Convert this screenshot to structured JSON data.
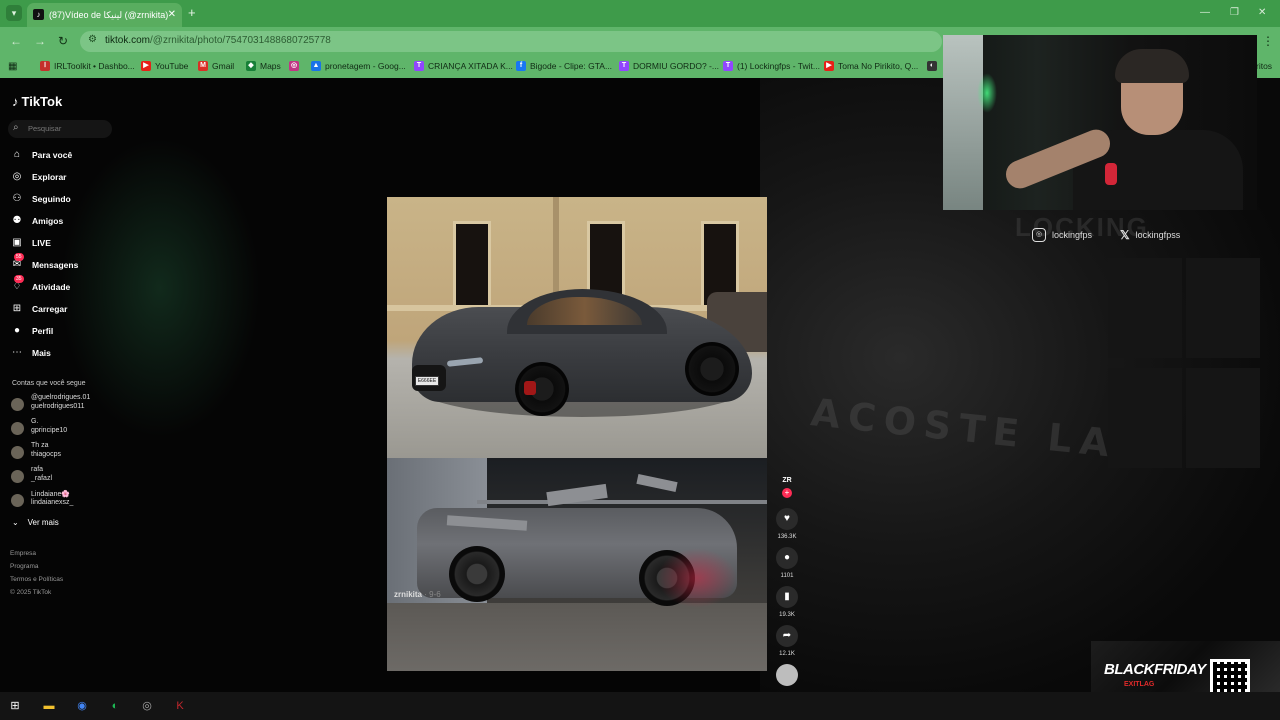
{
  "browser": {
    "tab_title": "(87)Vídeo de لينيكا (@zrnikita)",
    "url_host": "tiktok.com",
    "url_path": "/@zrnikita/photo/7547031488680725778",
    "bookmarks": [
      {
        "label": "IRLToolkit • Dashbo...",
        "icon": "irltoolkit-icon",
        "color": "#c4302b"
      },
      {
        "label": "YouTube",
        "icon": "youtube-icon",
        "color": "#e62117"
      },
      {
        "label": "Gmail",
        "icon": "gmail-icon",
        "color": "#d93025"
      },
      {
        "label": "Maps",
        "icon": "maps-icon",
        "color": "#188038"
      },
      {
        "label": "",
        "icon": "instagram-icon",
        "color": "#c13584"
      },
      {
        "label": "pronetagem - Goog...",
        "icon": "drive-icon",
        "color": "#1a73e8"
      },
      {
        "label": "CRIANÇA XITADA K...",
        "icon": "twitch-icon",
        "color": "#9146ff"
      },
      {
        "label": "Bigode - Clipe: GTA...",
        "icon": "facebook-icon",
        "color": "#1877f2"
      },
      {
        "label": "DORMIU GORDO? -...",
        "icon": "twitch-icon",
        "color": "#9146ff"
      },
      {
        "label": "(1) Lockingfps - Twit...",
        "icon": "twitch-icon",
        "color": "#9146ff"
      },
      {
        "label": "Toma No Pirikito, Q...",
        "icon": "youtube-icon",
        "color": "#e62117"
      },
      {
        "label": "",
        "icon": "misc-icon",
        "color": "#333333"
      }
    ],
    "bookmarks_overflow": "ritos"
  },
  "tiktok": {
    "logo": "TikTok",
    "search_placeholder": "Pesquisar",
    "nav": [
      {
        "label": "Para você",
        "icon": "home-icon",
        "badge": ""
      },
      {
        "label": "Explorar",
        "icon": "compass-icon",
        "badge": ""
      },
      {
        "label": "Seguindo",
        "icon": "following-icon",
        "badge": ""
      },
      {
        "label": "Amigos",
        "icon": "friends-icon",
        "badge": ""
      },
      {
        "label": "LIVE",
        "icon": "live-icon",
        "badge": ""
      },
      {
        "label": "Mensagens",
        "icon": "messages-icon",
        "badge": "55"
      },
      {
        "label": "Atividade",
        "icon": "activity-icon",
        "badge": "35"
      },
      {
        "label": "Carregar",
        "icon": "upload-icon",
        "badge": ""
      },
      {
        "label": "Perfil",
        "icon": "profile-icon",
        "badge": ""
      },
      {
        "label": "Mais",
        "icon": "more-icon",
        "badge": ""
      }
    ],
    "following_header": "Contas que você segue",
    "following": [
      {
        "name": "@guelrodrigues.01",
        "handle": "guelrodrigues011"
      },
      {
        "name": "G.",
        "handle": "gprincipe10"
      },
      {
        "name": "Th za",
        "handle": "thiagocps"
      },
      {
        "name": "rafa",
        "handle": "_rafazl"
      },
      {
        "name": "Lindaiane🌸",
        "handle": "lindaianexsz_"
      }
    ],
    "see_more": "Ver mais",
    "footer": [
      "Empresa",
      "Programa",
      "Termos e Políticas",
      "© 2025 TikTok"
    ],
    "post": {
      "author": "zrnikita",
      "date": "· 9-6",
      "author_badge": "ZR",
      "likes": "136.3K",
      "comments": "1101",
      "saves": "19.3K",
      "shares": "12.1K"
    }
  },
  "stream_overlay": {
    "instagram": "lockingfps",
    "x_handle": "lockingfpss",
    "bg_brand": "LOCKING",
    "promo_title": "BLACKFRIDAY",
    "promo_sub": "EXITLAG"
  },
  "taskbar": [
    {
      "icon": "windows-start-icon",
      "color": "#ffffff"
    },
    {
      "icon": "file-explorer-icon",
      "color": "#f2c12e"
    },
    {
      "icon": "chrome-icon",
      "color": "#4285f4"
    },
    {
      "icon": "spotify-icon",
      "color": "#1db954"
    },
    {
      "icon": "obs-icon",
      "color": "#aaaaaa"
    },
    {
      "icon": "app-icon",
      "color": "#c2272d"
    }
  ]
}
